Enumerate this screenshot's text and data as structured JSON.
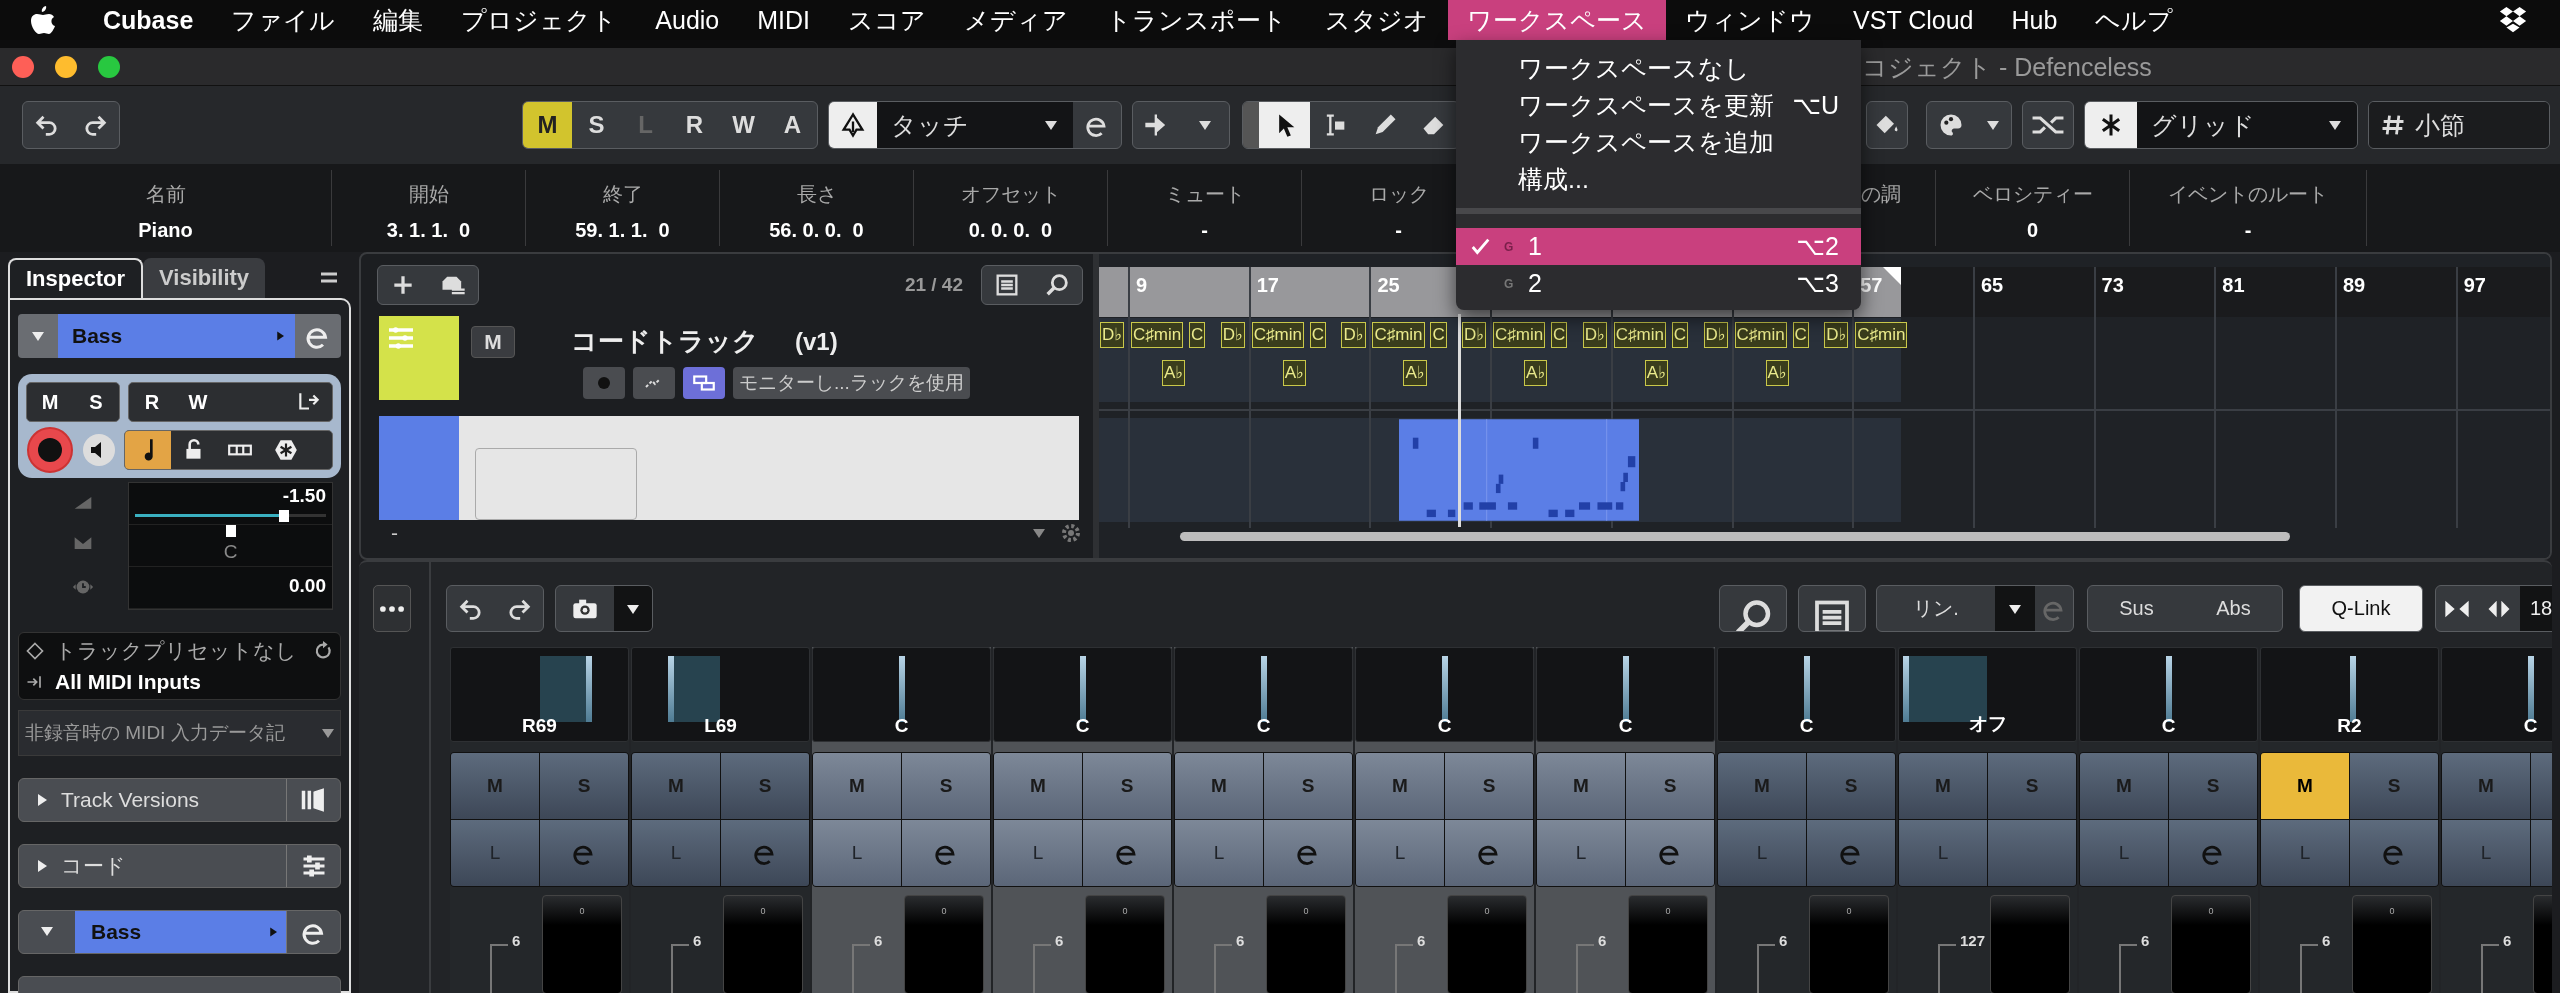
{
  "menu_bar": {
    "app_name": "Cubase",
    "items": [
      {
        "label": "ファイル",
        "selected": false
      },
      {
        "label": "編集",
        "selected": false
      },
      {
        "label": "プロジェクト",
        "selected": false
      },
      {
        "label": "Audio",
        "selected": false
      },
      {
        "label": "MIDI",
        "selected": false
      },
      {
        "label": "スコア",
        "selected": false
      },
      {
        "label": "メディア",
        "selected": false
      },
      {
        "label": "トランスポート",
        "selected": false
      },
      {
        "label": "スタジオ",
        "selected": false
      },
      {
        "label": "ワークスペース",
        "selected": true
      },
      {
        "label": "ウィンドウ",
        "selected": false
      },
      {
        "label": "VST Cloud",
        "selected": false
      },
      {
        "label": "Hub",
        "selected": false
      },
      {
        "label": "ヘルプ",
        "selected": false
      }
    ]
  },
  "workspace_menu": {
    "items": [
      {
        "kind": "command",
        "label": "ワークスペースなし"
      },
      {
        "kind": "command",
        "label": "ワークスペースを更新",
        "shortcut": "⌥U"
      },
      {
        "kind": "command",
        "label": "ワークスペースを追加"
      },
      {
        "kind": "command",
        "label": "構成..."
      },
      {
        "kind": "separator"
      },
      {
        "kind": "workspace",
        "group": "G",
        "label": "1",
        "shortcut": "⌥2",
        "checked": true,
        "selected": true
      },
      {
        "kind": "workspace",
        "group": "G",
        "label": "2",
        "shortcut": "⌥3",
        "checked": false,
        "selected": false
      }
    ]
  },
  "window": {
    "title": "コジェクト - Defenceless"
  },
  "toolbar": {
    "modes": [
      {
        "label": "M",
        "on": true,
        "disabled": false
      },
      {
        "label": "S",
        "on": false,
        "disabled": false
      },
      {
        "label": "L",
        "on": false,
        "disabled": true
      },
      {
        "label": "R",
        "on": false,
        "disabled": false
      },
      {
        "label": "W",
        "on": false,
        "disabled": false
      },
      {
        "label": "A",
        "on": false,
        "disabled": false
      }
    ],
    "automation_mode": "タッチ",
    "snap_type": "グリッド",
    "grid": "小節"
  },
  "info_line": {
    "columns": [
      {
        "kind": "field",
        "header": "名前",
        "value": "Piano"
      },
      {
        "kind": "field",
        "header": "開始",
        "value": "3. 1. 1.  0"
      },
      {
        "kind": "field",
        "header": "終了",
        "value": "59. 1. 1.  0"
      },
      {
        "kind": "field",
        "header": "長さ",
        "value": "56. 0. 0.  0"
      },
      {
        "kind": "field",
        "header": "オフセット",
        "value": "0. 0. 0.  0"
      },
      {
        "kind": "field",
        "header": "ミュート",
        "value": "-"
      },
      {
        "kind": "field",
        "header": "ロック",
        "value": "-"
      },
      {
        "kind": "covered",
        "header": "の調"
      },
      {
        "kind": "field",
        "header": "ベロシティー",
        "value": "0"
      },
      {
        "kind": "field",
        "header": "イベントのルート",
        "value": "-"
      }
    ]
  },
  "inspector": {
    "tabs": [
      {
        "label": "Inspector",
        "selected": true
      },
      {
        "label": "Visibility",
        "selected": false
      }
    ],
    "track": {
      "name": "Bass",
      "mute": "M",
      "solo": "S",
      "read": "R",
      "write": "W"
    },
    "volume": {
      "reading": "-1.50",
      "level": 0.78
    },
    "pan": {
      "reading": "C",
      "level": 0.5
    },
    "delay": {
      "reading": "0.00"
    },
    "preset": "トラックプリセットなし",
    "midi_input": "All MIDI Inputs",
    "input_filter": "非録音時の MIDI 入力データ記",
    "sections": [
      {
        "kind": "versions",
        "label": "Track Versions",
        "expanded": false
      },
      {
        "kind": "chord",
        "label": "コード",
        "expanded": false
      },
      {
        "kind": "track",
        "label": "Bass",
        "expanded": true
      }
    ]
  },
  "project": {
    "track_count": "21 / 42",
    "tracks": [
      {
        "kind": "chord",
        "name": "コードトラック",
        "version": "(v1)",
        "mute": "M",
        "monitor": "モニターし...ラックを使用",
        "color": "#d4e24a"
      },
      {
        "kind": "instrument",
        "color": "#5b7ee6"
      }
    ],
    "footer": "-",
    "ruler": [
      "9",
      "17",
      "25",
      "57",
      "65",
      "73",
      "81",
      "89",
      "97"
    ],
    "chord_groups": [
      {
        "chords": [
          "D♭",
          "C♯min",
          "C"
        ],
        "scale": "A♭"
      },
      {
        "chords": [
          "D♭",
          "C♯min",
          "C"
        ],
        "scale": "A♭"
      },
      {
        "chords": [
          "D♭",
          "C♯min",
          "C"
        ],
        "scale": "A♭"
      },
      {
        "chords": [
          "D♭",
          "C♯min",
          "C"
        ],
        "scale": "A♭"
      },
      {
        "chords": [
          "D♭",
          "C♯min",
          "C"
        ],
        "scale": "A♭"
      },
      {
        "chords": [
          "D♭",
          "C♯min",
          "C"
        ],
        "scale": "A♭"
      },
      {
        "chords": [
          "D♭",
          "C♯min"
        ]
      }
    ]
  },
  "mixer": {
    "link": "リン.",
    "sus": "Sus",
    "abs": "Abs",
    "qlink": {
      "label": "Q-Link",
      "on": true
    },
    "value": "18",
    "channels": [
      {
        "pan": "R69",
        "level": 0.78,
        "selected": false,
        "m": "M",
        "s": "S",
        "l": "L",
        "muted": false,
        "edit": true,
        "fader": "6",
        "mark": "0"
      },
      {
        "pan": "L69",
        "level": 0.22,
        "selected": false,
        "m": "M",
        "s": "S",
        "l": "L",
        "muted": false,
        "edit": true,
        "fader": "6",
        "mark": "0"
      },
      {
        "pan": "C",
        "level": 0.5,
        "selected": true,
        "m": "M",
        "s": "S",
        "l": "L",
        "muted": false,
        "edit": true,
        "fader": "6",
        "mark": "0"
      },
      {
        "pan": "C",
        "level": 0.5,
        "selected": true,
        "m": "M",
        "s": "S",
        "l": "L",
        "muted": false,
        "edit": true,
        "fader": "6",
        "mark": "0"
      },
      {
        "pan": "C",
        "level": 0.5,
        "selected": true,
        "m": "M",
        "s": "S",
        "l": "L",
        "muted": false,
        "edit": true,
        "fader": "6",
        "mark": "0"
      },
      {
        "pan": "C",
        "level": 0.5,
        "selected": true,
        "m": "M",
        "s": "S",
        "l": "L",
        "muted": false,
        "edit": true,
        "fader": "6",
        "mark": "0"
      },
      {
        "pan": "C",
        "level": 0.5,
        "selected": true,
        "m": "M",
        "s": "S",
        "l": "L",
        "muted": false,
        "edit": true,
        "fader": "6",
        "mark": "0"
      },
      {
        "pan": "C",
        "level": 0.5,
        "selected": false,
        "m": "M",
        "s": "S",
        "l": "L",
        "muted": false,
        "edit": true,
        "fader": "6",
        "mark": "0"
      },
      {
        "pan": "オフ",
        "level": 0.04,
        "selected": false,
        "m": "M",
        "s": "S",
        "l": "L",
        "muted": false,
        "edit": false,
        "fader": "127"
      },
      {
        "pan": "C",
        "level": 0.5,
        "selected": false,
        "m": "M",
        "s": "S",
        "l": "L",
        "muted": false,
        "edit": true,
        "fader": "6",
        "mark": "0"
      },
      {
        "pan": "R2",
        "level": 0.52,
        "selected": false,
        "m": "M",
        "s": "S",
        "l": "L",
        "muted": true,
        "edit": true,
        "fader": "6",
        "mark": "0"
      },
      {
        "pan": "C",
        "level": 0.5,
        "selected": false,
        "m": "M",
        "l": "L",
        "muted": false,
        "edit": false,
        "fader": "6"
      }
    ]
  }
}
